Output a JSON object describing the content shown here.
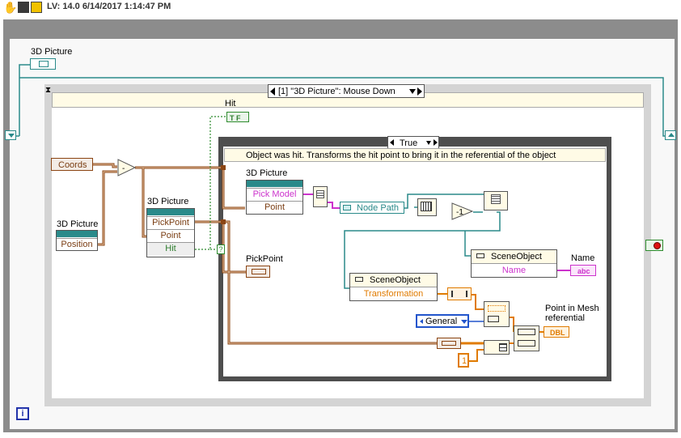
{
  "header": {
    "version": "LV: 14.0 6/14/2017 1:14:47 PM"
  },
  "controls": {
    "picture_top": "3D Picture",
    "picture_pickpoint_node": "3D Picture",
    "picture_position_node": "3D Picture",
    "picture_pickmodel_node": "3D Picture"
  },
  "event_structure": {
    "selector": "[1] \"3D Picture\": Mouse Down"
  },
  "event_data": {
    "coords": "Coords"
  },
  "nodes": {
    "position_node_row": "Position",
    "pickpoint_node_rows": [
      "PickPoint",
      "Point",
      "Hit"
    ],
    "pickmodel_node_rows": [
      "Pick Model",
      "Point"
    ],
    "node_path": "Node Path",
    "scene_object_1": {
      "title": "SceneObject",
      "row": "Transformation"
    },
    "scene_object_2": {
      "title": "SceneObject",
      "row": "Name"
    }
  },
  "case_structure": {
    "selector": "True",
    "comment": "Object was hit. Transforms the hit point to bring it in the referential of the object"
  },
  "indicators": {
    "hit": "Hit",
    "pickpoint": "PickPoint",
    "name": "Name",
    "point_in_mesh": "Point in Mesh referential"
  },
  "constants": {
    "general": "General",
    "one": "1"
  },
  "terminals": {
    "tf": "T F",
    "abc": "abc",
    "dbl": "DBL"
  },
  "colors": {
    "while_loop_frame": "#8c8c8c",
    "event_frame": "#d9d9d9",
    "case_frame": "#5a5a5a",
    "refnum_wire": "#2a8a8a",
    "cluster_wire": "#a0522d",
    "bool_wire": "#2e8b2e",
    "string_wire": "#cc33cc",
    "dbl_wire": "#e07b00",
    "enum_wire": "#2255cc"
  }
}
